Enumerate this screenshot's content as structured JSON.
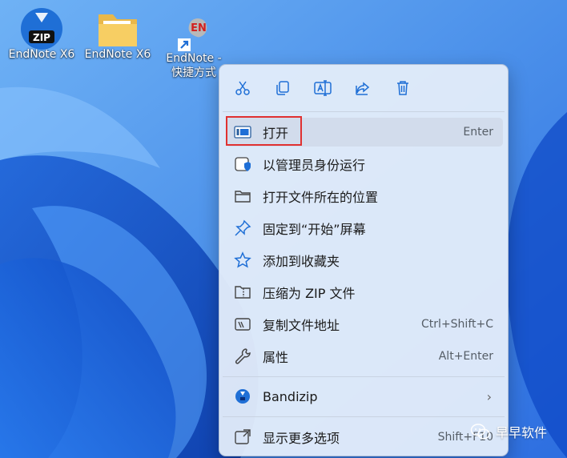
{
  "desktop": {
    "icons": [
      {
        "label": "EndNote X6",
        "icon": "zip-app-icon"
      },
      {
        "label": "EndNote X6",
        "icon": "folder-icon"
      },
      {
        "label_line1": "EndNote -",
        "label_line2": "快捷方式",
        "badge": "EN",
        "icon": "endnote-shortcut-icon"
      }
    ]
  },
  "context_menu": {
    "toolbar": [
      {
        "icon": "cut-icon"
      },
      {
        "icon": "copy-icon"
      },
      {
        "icon": "rename-icon"
      },
      {
        "icon": "share-icon"
      },
      {
        "icon": "delete-icon"
      }
    ],
    "items": [
      {
        "label": "打开",
        "shortcut": "Enter",
        "icon": "open-icon"
      },
      {
        "label": "以管理员身份运行",
        "icon": "run-as-admin-icon"
      },
      {
        "label": "打开文件所在的位置",
        "icon": "folder-outline-icon"
      },
      {
        "label": "固定到“开始”屏幕",
        "icon": "pin-icon"
      },
      {
        "label": "添加到收藏夹",
        "icon": "star-icon"
      },
      {
        "label": "压缩为 ZIP 文件",
        "icon": "zip-folder-icon"
      },
      {
        "label": "复制文件地址",
        "shortcut": "Ctrl+Shift+C",
        "icon": "copy-path-icon"
      },
      {
        "label": "属性",
        "shortcut": "Alt+Enter",
        "icon": "wrench-icon"
      },
      {
        "label": "Bandizip",
        "icon": "bandizip-icon"
      },
      {
        "label": "显示更多选项",
        "shortcut": "Shift+F10",
        "icon": "more-options-icon"
      }
    ]
  },
  "watermark": {
    "text": "早早软件",
    "icon": "wechat-icon"
  },
  "colors": {
    "highlight_border": "#e03131",
    "accent": "#1f6fd6"
  }
}
